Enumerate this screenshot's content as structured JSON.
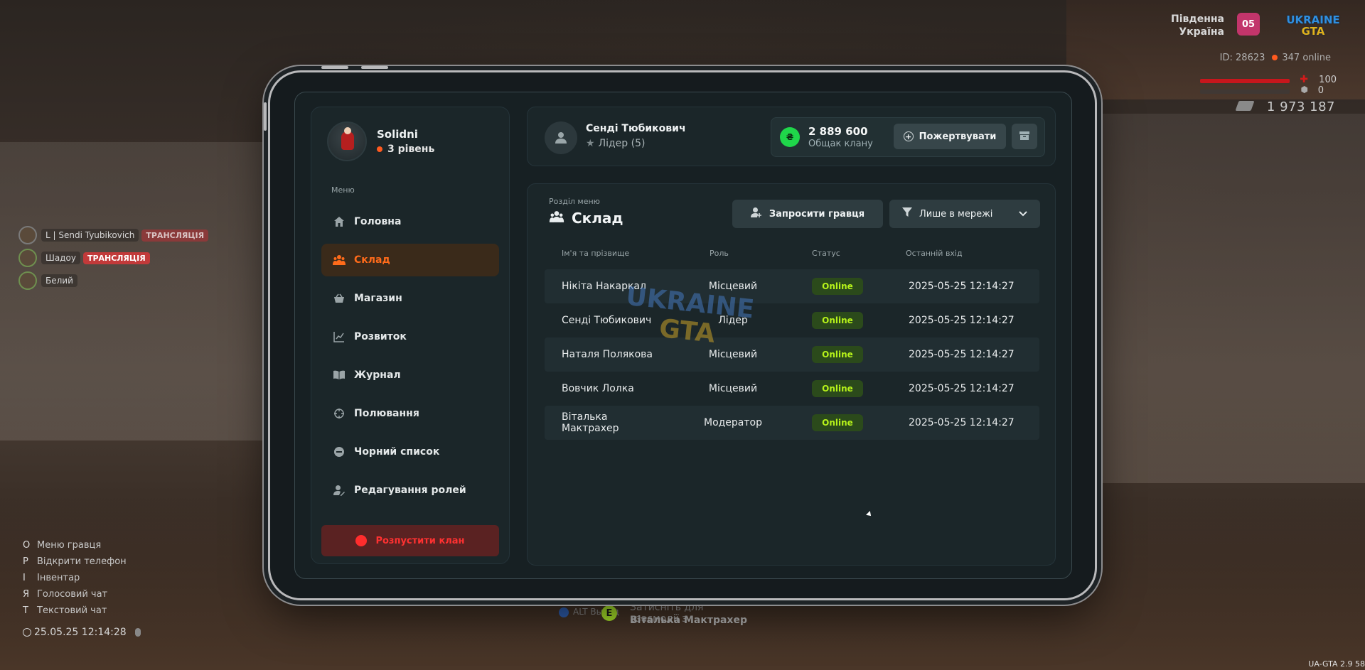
{
  "hud": {
    "region_line1": "Південна",
    "region_line2": "Україна",
    "region_code": "05",
    "logo_top": "UKRAINE",
    "logo_bottom": "GTA",
    "server_id": "ID: 28623",
    "online": "347 online",
    "health": "100",
    "armor": "0",
    "money": "1 973 187"
  },
  "voice": [
    {
      "name": "L | Sendi Tyubikovich",
      "tag": "ТРАНСЛЯЦІЯ"
    },
    {
      "name": "Шадоу",
      "tag": "ТРАНСЛЯЦІЯ"
    },
    {
      "name": "Белий",
      "tag": ""
    }
  ],
  "keys": [
    {
      "key": "O",
      "label": "Меню гравця"
    },
    {
      "key": "P",
      "label": "Відкрити телефон"
    },
    {
      "key": "I",
      "label": "Інвентар"
    },
    {
      "key": "Я",
      "label": "Голосовий чат"
    },
    {
      "key": "T",
      "label": "Текстовий чат"
    }
  ],
  "clock": "25.05.25 12:14:28",
  "interact": {
    "alt": "ALT Выход",
    "key": "E",
    "line1": "Затисніть для взаємодії з",
    "line2": "Віталька Мактрахер"
  },
  "version": "UA-GTA 2.9   58",
  "profile": {
    "name": "Solidni",
    "level": "3 рівень"
  },
  "menu_label": "Меню",
  "nav": [
    {
      "label": "Головна",
      "icon": "home-icon"
    },
    {
      "label": "Склад",
      "icon": "people-icon"
    },
    {
      "label": "Магазин",
      "icon": "basket-icon"
    },
    {
      "label": "Розвиток",
      "icon": "chart-icon"
    },
    {
      "label": "Журнал",
      "icon": "book-icon"
    },
    {
      "label": "Полювання",
      "icon": "crosshair-icon"
    },
    {
      "label": "Чорний список",
      "icon": "block-icon"
    },
    {
      "label": "Редагування ролей",
      "icon": "user-edit-icon"
    }
  ],
  "disband_label": "Розпустити клан",
  "user": {
    "name": "Сенді Тюбикович",
    "role": "Лідер (5)"
  },
  "fund": {
    "amount": "2 889 600",
    "label": "Общак клану",
    "donate": "Пожертвувати"
  },
  "section": {
    "label": "Розділ меню",
    "title": "Склад",
    "invite": "Запросити гравця",
    "filter": "Лише в мережі"
  },
  "table": {
    "headers": [
      "Ім'я та прізвище",
      "Роль",
      "Статус",
      "Останній вхід"
    ],
    "rows": [
      {
        "name": "Нікіта Накаркал",
        "role": "Місцевий",
        "status": "Online",
        "last": "2025-05-25 12:14:27"
      },
      {
        "name": "Сенді Тюбикович",
        "role": "Лідер",
        "status": "Online",
        "last": "2025-05-25 12:14:27"
      },
      {
        "name": "Наталя Полякова",
        "role": "Місцевий",
        "status": "Online",
        "last": "2025-05-25 12:14:27"
      },
      {
        "name": "Вовчик Лолка",
        "role": "Місцевий",
        "status": "Online",
        "last": "2025-05-25 12:14:27"
      },
      {
        "name": "Віталька Мактрахер",
        "role": "Модератор",
        "status": "Online",
        "last": "2025-05-25 12:14:27"
      }
    ]
  },
  "watermark": {
    "top": "UKRAINE",
    "bottom": "GTA"
  }
}
